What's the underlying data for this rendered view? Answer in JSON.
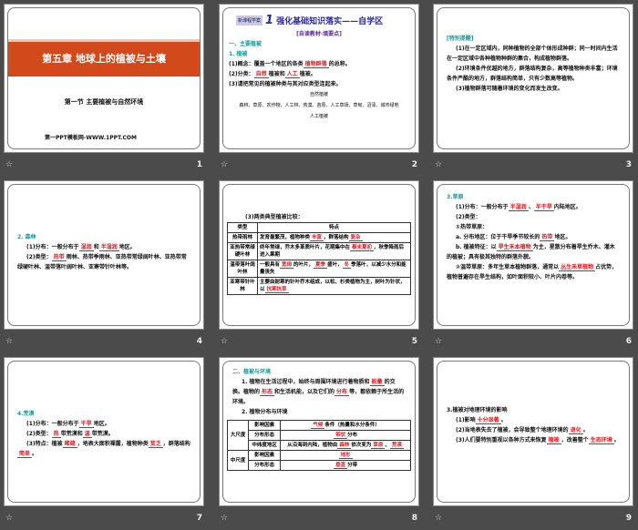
{
  "slides": [
    {
      "number": "1",
      "title": "第五章 地球上的植被与土壤",
      "subtitle": "第一节  主要植被与自然环境",
      "site": "第一PPT模板网-WWW.1PPT.COM"
    },
    {
      "number": "2",
      "logo": "新课程学案",
      "big_num": "1",
      "header": "强化基础知识落实——自学区",
      "tag": "[自读教材·填要点]",
      "paras": [
        [
          {
            "t": "一、主要植被",
            "c": "teal"
          }
        ],
        [
          {
            "t": "1. 植被",
            "c": "teal"
          }
        ],
        [
          {
            "t": "(1)概念：覆盖一个地区的各类"
          },
          {
            "t": "植物群落",
            "b": 1
          },
          {
            "t": "的总称。"
          }
        ],
        [
          {
            "t": "(2)分类："
          },
          {
            "t": "自然",
            "b": 1
          },
          {
            "t": "植被和"
          },
          {
            "t": "人工",
            "b": 1
          },
          {
            "t": "植被。"
          }
        ],
        [
          {
            "t": "(3)请把常见的植被种类与其对应类型连起来。"
          }
        ]
      ],
      "diagram": {
        "top": "自然植被",
        "items": "森林、草原、农作物、人工林、荒漠、苔原、人工草场、草甸、沼泽、城市绿地",
        "bottom": "人工植被"
      }
    },
    {
      "number": "3",
      "paras": [
        [
          {
            "t": "[特别提醒]",
            "c": "teal"
          }
        ],
        [
          {
            "t": "(1)在一定区域内，同种植物的全部个体形成种群；同一时间内生活在一定区域中各种植物种群的集合，构成植物群落。"
          }
        ],
        [
          {
            "t": "(2)环境条件优越的地方，群落结构复杂，高等植物种类丰富；环境条件严酷的地方，群落结构简单，只有少数高等植物。"
          }
        ],
        [
          {
            "t": "(3)植物群落可随着环境的变化而发生改变。"
          }
        ]
      ]
    },
    {
      "number": "4",
      "paras": [
        [
          {
            "t": "2. 森林",
            "c": "teal"
          }
        ],
        [
          {
            "t": "(1)分布：一般分布于"
          },
          {
            "t": "湿润",
            "b": 1
          },
          {
            "t": "和"
          },
          {
            "t": "半湿润",
            "b": 1
          },
          {
            "t": "地区。"
          }
        ],
        [
          {
            "t": "(2)类型："
          },
          {
            "t": "热带",
            "b": 1
          },
          {
            "t": "雨林、热带季雨林、亚热带常绿阔叶林、亚热带常绿硬叶林、温带落叶阔叶林、亚寒带针叶林等。"
          }
        ]
      ]
    },
    {
      "number": "5",
      "caption": "(3)两类典型植被比较：",
      "headers": [
        "类型",
        "特点"
      ],
      "rows": [
        {
          "type": "热带雨林",
          "cells": [
            {
              "t": "发育最繁茂，植物种类"
            },
            {
              "t": "丰富",
              "b": 1
            },
            {
              "t": "，群落结构"
            },
            {
              "t": "复杂",
              "b": 1
            }
          ]
        },
        {
          "type": "亚热带常绿硬叶林",
          "cells": [
            {
              "t": "终年常绿，乔木多革质叶片，花期集中在"
            },
            {
              "t": "春末夏初",
              "b": 1
            },
            {
              "t": "，秋季降雨后进入果期"
            }
          ]
        },
        {
          "type": "温带落叶阔叶林",
          "cells": [
            {
              "t": "一般具有"
            },
            {
              "t": "宽阔",
              "b": 1
            },
            {
              "t": "的叶片，"
            },
            {
              "t": "夏季",
              "b": 1
            },
            {
              "t": "盛叶，"
            },
            {
              "t": "冬",
              "b": 1
            },
            {
              "t": "季落叶，以减少水分和能量丧失"
            }
          ]
        },
        {
          "type": "亚寒带针叶林",
          "cells": [
            {
              "t": "主要由耐寒的针叶乔木组成，以松、杉类植物为主，树叶为针状，以"
            },
            {
              "t": "抗寒抗旱",
              "b": 1
            }
          ]
        }
      ]
    },
    {
      "number": "6",
      "paras": [
        [
          {
            "t": "3.草原",
            "c": "teal"
          }
        ],
        [
          {
            "t": "(1)分布：一般分布于"
          },
          {
            "t": "半湿润",
            "b": 1
          },
          {
            "t": "、"
          },
          {
            "t": "半干旱",
            "b": 1
          },
          {
            "t": "内陆地区。"
          }
        ],
        [
          {
            "t": "(2)类型："
          }
        ],
        [
          {
            "t": "①热带草原："
          }
        ],
        [
          {
            "t": "a. 分布地区：位于干旱季节较长的"
          },
          {
            "t": "热带",
            "b": 1
          },
          {
            "t": "地区。"
          }
        ],
        [
          {
            "t": "b. 植被特征：以"
          },
          {
            "t": "旱生禾本植物",
            "b": 1
          },
          {
            "t": "为主，星散分布着旱生乔木、灌木的植被；具有极其独特的群落外貌。"
          }
        ],
        [
          {
            "t": "②温带草原：多年生草本植物群落，通常以"
          },
          {
            "t": "丛生禾草植物",
            "b": 1
          },
          {
            "t": "占优势，植物普遍存在旱生结构，如叶面积较小、叶片内卷等。"
          }
        ]
      ]
    },
    {
      "number": "7",
      "paras": [
        [
          {
            "t": "4.荒漠",
            "c": "teal"
          }
        ],
        [
          {
            "t": "(1)分布：一般分布于"
          },
          {
            "t": "干旱",
            "b": 1
          },
          {
            "t": "地区。"
          }
        ],
        [
          {
            "t": "(2)类型："
          },
          {
            "t": "热",
            "b": 1
          },
          {
            "t": "带荒漠和"
          },
          {
            "t": "温",
            "b": 1
          },
          {
            "t": "带荒漠。"
          }
        ],
        [
          {
            "t": "(3)特点：植被"
          },
          {
            "t": "稀疏",
            "b": 1
          },
          {
            "t": "，地表大面积裸露，植物种类"
          },
          {
            "t": "贫乏",
            "b": 1
          },
          {
            "t": "，群落结构"
          },
          {
            "t": "简单",
            "b": 1
          },
          {
            "t": "。"
          }
        ]
      ]
    },
    {
      "number": "8",
      "paras": [
        [
          {
            "t": "二、植被与环境",
            "c": "teal"
          }
        ],
        [
          {
            "t": "1. 植物在生活过程中，始终与周围环境进行着物质和"
          },
          {
            "t": "能量",
            "b": 1
          },
          {
            "t": "的交换。植物的"
          },
          {
            "t": "形态",
            "b": 1
          },
          {
            "t": "和生活机能，以及它们的"
          },
          {
            "t": "分布",
            "b": 1
          },
          {
            "t": "等，都依赖于所生活的环境。"
          }
        ],
        [
          {
            "t": "2. 植物分布与环境"
          }
        ]
      ],
      "table": [
        {
          "scale": "大尺度",
          "label": "影响因素",
          "cells": [
            {
              "t": "气候",
              "b": 1
            },
            {
              "t": "条件（热量和水分条件）"
            }
          ]
        },
        {
          "label": "分布形态",
          "cells": [
            {
              "t": "带状",
              "b": 1
            },
            {
              "t": "分布"
            }
          ]
        },
        {
          "label": "中纬度地区",
          "cells": [
            {
              "t": "从沿海到内陆，植物由"
            },
            {
              "t": "森林",
              "b": 1
            },
            {
              "t": "依次变为"
            },
            {
              "t": "草原",
              "b": 1
            },
            {
              "t": "、"
            },
            {
              "t": "荒漠",
              "b": 1
            }
          ]
        },
        {
          "scale": "中尺度",
          "label": "影响因素",
          "cells": [
            {
              "t": "地形",
              "b": 1
            }
          ]
        },
        {
          "label": "分布形态",
          "cells": [
            {
              "t": "垂直",
              "b": 1
            },
            {
              "t": "分带"
            }
          ]
        }
      ]
    },
    {
      "number": "9",
      "paras": [
        [
          {
            "t": "3.植被对地理环境的影响"
          }
        ],
        [
          {
            "t": "(1)影响"
          },
          {
            "t": "十分显著",
            "b": 1
          },
          {
            "t": "。"
          }
        ],
        [
          {
            "t": "(2)当地表失去了植被，会导致整个地理环境的"
          },
          {
            "t": "退化",
            "b": 1
          },
          {
            "t": "。"
          }
        ],
        [
          {
            "t": "(3)人们要特别重视以各种方式来恢复"
          },
          {
            "t": "植被",
            "b": 1
          },
          {
            "t": "，改善整个"
          },
          {
            "t": "生态环境",
            "b": 1
          },
          {
            "t": "。"
          }
        ]
      ]
    }
  ],
  "star_icon": "☆"
}
